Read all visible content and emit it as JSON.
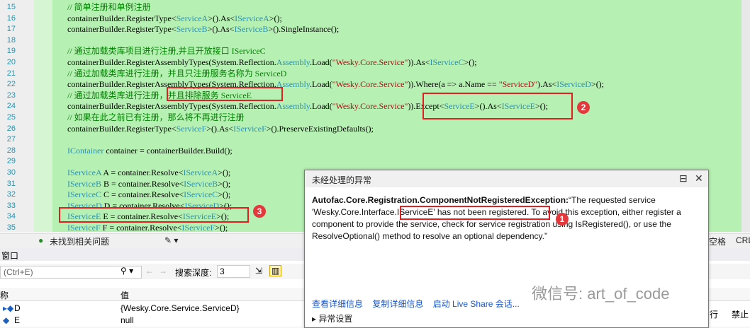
{
  "code_lines": [
    {
      "n": "15",
      "parts": [
        [
          "cm",
          "// 简单注册和单例注册"
        ]
      ]
    },
    {
      "n": "16",
      "parts": [
        [
          "",
          "containerBuilder.RegisterType<"
        ],
        [
          "ty",
          "ServiceA"
        ],
        [
          "",
          ">().As<"
        ],
        [
          "ty",
          "IServiceA"
        ],
        [
          "",
          ">();"
        ]
      ]
    },
    {
      "n": "17",
      "parts": [
        [
          "",
          "containerBuilder.RegisterType<"
        ],
        [
          "ty",
          "ServiceB"
        ],
        [
          "",
          ">().As<"
        ],
        [
          "ty",
          "IServiceB"
        ],
        [
          "",
          ">().SingleInstance();"
        ]
      ]
    },
    {
      "n": "18",
      "parts": []
    },
    {
      "n": "19",
      "parts": [
        [
          "cm",
          "// 通过加载类库项目进行注册,并且开放接口 IServiceC"
        ]
      ]
    },
    {
      "n": "20",
      "parts": [
        [
          "",
          "containerBuilder.RegisterAssemblyTypes(System.Reflection."
        ],
        [
          "ty",
          "Assembly"
        ],
        [
          "",
          ".Load("
        ],
        [
          "st",
          "\"Wesky.Core.Service\""
        ],
        [
          "",
          "))."
        ],
        [
          "",
          "As<"
        ],
        [
          "ty",
          "IServiceC"
        ],
        [
          "",
          ">();"
        ]
      ]
    },
    {
      "n": "21",
      "parts": [
        [
          "cm",
          "// 通过加载类库进行注册，并且只注册服务名称为 ServiceD"
        ]
      ]
    },
    {
      "n": "22",
      "parts": [
        [
          "",
          "containerBuilder.RegisterAssemblyTypes(System.Reflection."
        ],
        [
          "ty",
          "Assembly"
        ],
        [
          "",
          ".Load("
        ],
        [
          "st",
          "\"Wesky.Core.Service\""
        ],
        [
          "",
          ")).Where(a => a.Name == "
        ],
        [
          "st",
          "\"ServiceD\""
        ],
        [
          "",
          ").As<"
        ],
        [
          "ty",
          "IServiceD"
        ],
        [
          "",
          ">();"
        ]
      ]
    },
    {
      "n": "23",
      "parts": [
        [
          "cm",
          "// 通过加载类库进行注册，并且排除服务 ServiceE"
        ]
      ]
    },
    {
      "n": "24",
      "parts": [
        [
          "",
          "containerBuilder.RegisterAssemblyTypes(System.Reflection."
        ],
        [
          "ty",
          "Assembly"
        ],
        [
          "",
          ".Load("
        ],
        [
          "st",
          "\"Wesky.Core.Service\""
        ],
        [
          "",
          ")).Except<"
        ],
        [
          "ty",
          "ServiceE"
        ],
        [
          "",
          ">().As<"
        ],
        [
          "ty",
          "IServiceE"
        ],
        [
          "",
          ">();"
        ]
      ]
    },
    {
      "n": "25",
      "parts": [
        [
          "cm",
          "// 如果在此之前已有注册，那么将不再进行注册"
        ]
      ]
    },
    {
      "n": "26",
      "parts": [
        [
          "",
          "containerBuilder.RegisterType<"
        ],
        [
          "ty",
          "ServiceF"
        ],
        [
          "",
          ">().As<"
        ],
        [
          "ty",
          "IServiceF"
        ],
        [
          "",
          ">().PreserveExistingDefaults();"
        ]
      ]
    },
    {
      "n": "27",
      "parts": []
    },
    {
      "n": "28",
      "parts": [
        [
          "ty",
          "IContainer"
        ],
        [
          "",
          " container = containerBuilder.Build();"
        ]
      ]
    },
    {
      "n": "29",
      "parts": []
    },
    {
      "n": "30",
      "parts": [
        [
          "ty",
          "IServiceA"
        ],
        [
          "",
          " A = container.Resolve<"
        ],
        [
          "ty",
          "IServiceA"
        ],
        [
          "",
          ">();"
        ]
      ]
    },
    {
      "n": "31",
      "parts": [
        [
          "ty",
          "IServiceB"
        ],
        [
          "",
          " B = container.Resolve<"
        ],
        [
          "ty",
          "IServiceB"
        ],
        [
          "",
          ">();"
        ]
      ]
    },
    {
      "n": "32",
      "parts": [
        [
          "ty",
          "IServiceC"
        ],
        [
          "",
          " C = container.Resolve<"
        ],
        [
          "ty",
          "IServiceC"
        ],
        [
          "",
          ">();"
        ]
      ]
    },
    {
      "n": "33",
      "parts": [
        [
          "ty",
          "IServiceD"
        ],
        [
          "",
          " D = container.Resolve<"
        ],
        [
          "ty",
          "IServiceD"
        ],
        [
          "",
          ">();"
        ]
      ]
    },
    {
      "n": "34",
      "parts": [
        [
          "ty",
          "IServiceE"
        ],
        [
          "",
          " E = container.Resolve<"
        ],
        [
          "ty",
          "IServiceE"
        ],
        [
          "",
          ">();"
        ]
      ]
    },
    {
      "n": "35",
      "parts": [
        [
          "ty",
          "IServiceF"
        ],
        [
          "",
          " F = container.Resolve<"
        ],
        [
          "ty",
          "IServiceF"
        ],
        [
          "",
          ">();"
        ]
      ]
    }
  ],
  "badges": {
    "b1": "1",
    "b2": "2",
    "b3": "3"
  },
  "status": {
    "no_issues": "未找到相关问题",
    "col_label": "空格",
    "crlf": "CRL"
  },
  "toolwindow": {
    "title": "窗口",
    "search_placeholder": "(Ctrl+E)",
    "depth_label": "搜索深度:",
    "depth_value": "3",
    "col_name": "称",
    "col_value": "值",
    "rows": [
      {
        "name": "D",
        "value": "{Wesky.Core.Service.ServiceD}"
      },
      {
        "name": "E",
        "value": "null"
      }
    ],
    "right_col1": "行",
    "right_col2": "禁止"
  },
  "dialog": {
    "title": "未经处理的异常",
    "exception": "Autofac.Core.Registration.ComponentNotRegisteredException:",
    "message": "“The requested service 'Wesky.Core.Interface.IServiceE' has not been registered. To avoid this exception, either register a component to provide the service, check for service registration using IsRegistered(), or use the ResolveOptional() method to resolve an optional dependency.”",
    "link1": "查看详细信息",
    "link2": "复制详细信息",
    "link3": "启动 Live Share 会话...",
    "settings": "异常设置"
  },
  "watermark": "微信号: art_of_code",
  "colors": {
    "editor_bg": "#b7f0b3",
    "highlight": "#e02020",
    "badge": "#e4393c",
    "link": "#1a55c9"
  }
}
